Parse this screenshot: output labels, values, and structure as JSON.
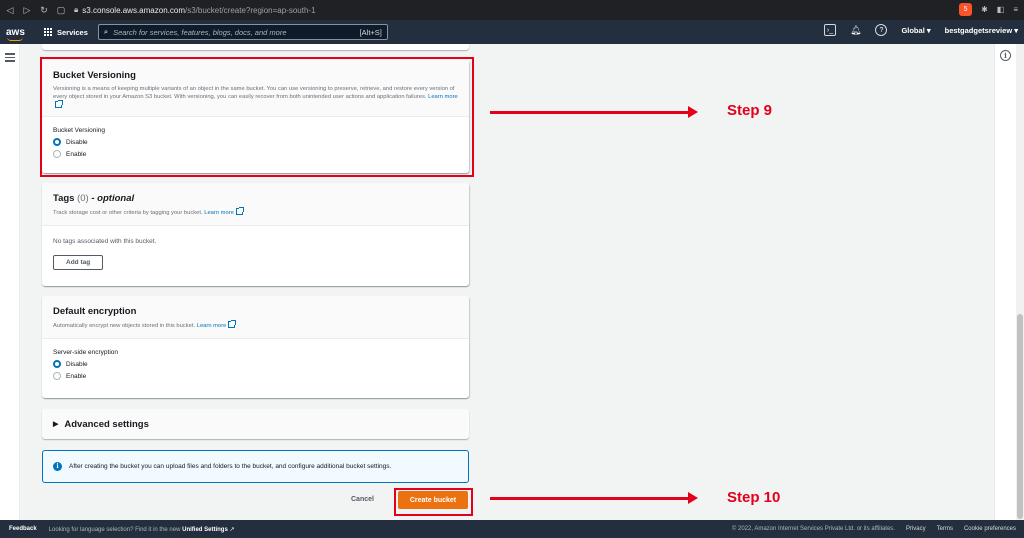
{
  "browser": {
    "url_domain": "s3.console.aws.amazon.com",
    "url_path": "/s3/bucket/create?region=ap-south-1",
    "brave_badge": "5"
  },
  "nav": {
    "logo": "aws",
    "services_label": "Services",
    "search_placeholder": "Search for services, features, blogs, docs, and more",
    "search_shortcut": "[Alt+S]",
    "region": "Global ▾",
    "account": "bestgadgetsreview ▾"
  },
  "versioning": {
    "title": "Bucket Versioning",
    "description": "Versioning is a means of keeping multiple variants of an object in the same bucket. You can use versioning to preserve, retrieve, and restore every version of every object stored in your Amazon S3 bucket. With versioning, you can easily recover from both unintended user actions and application failures.",
    "learn_more": "Learn more",
    "field_label": "Bucket Versioning",
    "options": [
      "Disable",
      "Enable"
    ],
    "selected": "Disable"
  },
  "tags": {
    "title": "Tags",
    "count": "(0)",
    "optional": "- optional",
    "description": "Track storage cost or other criteria by tagging your bucket.",
    "learn_more": "Learn more",
    "empty_text": "No tags associated with this bucket.",
    "add_button": "Add tag"
  },
  "encryption": {
    "title": "Default encryption",
    "description": "Automatically encrypt new objects stored in this bucket.",
    "learn_more": "Learn more",
    "field_label": "Server-side encryption",
    "options": [
      "Disable",
      "Enable"
    ],
    "selected": "Disable"
  },
  "advanced": {
    "label": "Advanced settings"
  },
  "info_alert": {
    "text": "After creating the bucket you can upload files and folders to the bucket, and configure additional bucket settings."
  },
  "actions": {
    "cancel": "Cancel",
    "create": "Create bucket"
  },
  "annotations": {
    "step9": "Step 9",
    "step10": "Step 10",
    "color": "#e3001b"
  },
  "footer": {
    "feedback": "Feedback",
    "lang_text": "Looking for language selection? Find it in the new",
    "lang_link": "Unified Settings",
    "copyright": "© 2022, Amazon Internet Services Private Ltd. or its affiliates.",
    "privacy": "Privacy",
    "terms": "Terms",
    "cookies": "Cookie preferences"
  }
}
